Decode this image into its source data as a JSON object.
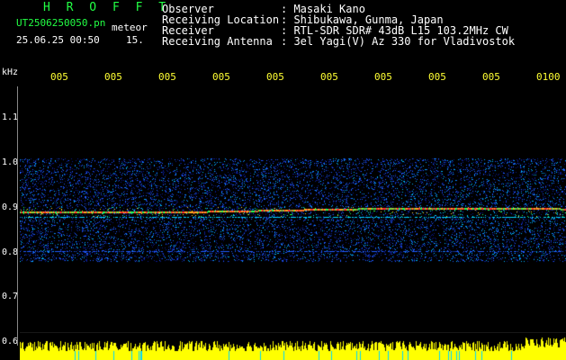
{
  "app": {
    "title": "H R O F F T",
    "file_name": "UT2506250050.pn",
    "meteor_label": "meteor",
    "date_time": "25.06.25 00:50",
    "frame_number": "15."
  },
  "header": {
    "observer_label": "Observer",
    "observer_value": ": Masaki Kano",
    "location_label": "Receiving Location",
    "location_value": ": Shibukawa, Gunma, Japan",
    "receiver_label": "Receiver",
    "receiver_value": ": RTL-SDR SDR# 43dB L15 103.2MHz CW",
    "antenna_label": "Receiving Antenna",
    "antenna_value": ": 3el Yagi(V) Az 330 for Vladivostok"
  },
  "axis": {
    "y_unit": "kHz",
    "y_ticks": [
      "1.1",
      "1.0",
      "0.9",
      "0.8",
      "0.7",
      "0.6"
    ],
    "x_ticks": [
      "005",
      "005",
      "005",
      "005",
      "005",
      "005",
      "005",
      "005",
      "005",
      "0100"
    ]
  },
  "colors": {
    "title_green": "#22ff44",
    "label_white": "#ffffff",
    "tick_yellow": "#ffff33",
    "background": "#000000",
    "noise_dark_blue": "#0a1a8c",
    "noise_blue": "#1e5aff",
    "noise_cyan": "#00d8ff",
    "noise_green": "#22ff55",
    "carrier_red": "#ff3030",
    "power_yellow": "#ffff00"
  }
}
